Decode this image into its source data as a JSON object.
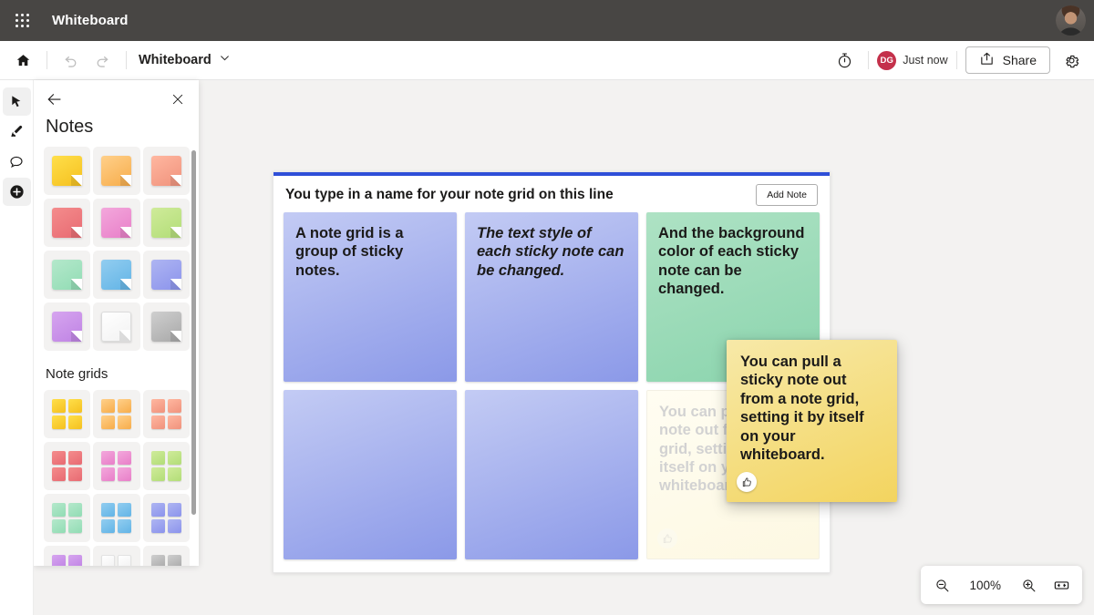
{
  "appbar": {
    "waffle_icon": "app-launcher-icon",
    "title": "Whiteboard",
    "avatar_icon": "user-avatar"
  },
  "toolbar": {
    "home_icon": "home-icon",
    "undo_icon": "undo-icon",
    "redo_icon": "redo-icon",
    "document_name": "Whiteboard",
    "chevron_icon": "chevron-down-icon",
    "timer_icon": "timer-icon",
    "presence_initials": "DG",
    "presence_status": "Just now",
    "share_icon": "share-icon",
    "share_label": "Share",
    "settings_icon": "gear-icon"
  },
  "rail": {
    "tools": [
      {
        "name": "select-tool",
        "icon": "cursor-arrow-icon",
        "selected": true
      },
      {
        "name": "pen-tool",
        "icon": "pen-icon",
        "selected": false
      },
      {
        "name": "comment-tool",
        "icon": "speech-bubble-icon",
        "selected": false
      },
      {
        "name": "create-tool",
        "icon": "plus-circle-icon",
        "selected": true
      }
    ]
  },
  "panel": {
    "back_icon": "back-arrow-icon",
    "close_icon": "close-icon",
    "title": "Notes",
    "grids_title": "Note grids",
    "note_colors": [
      {
        "label": "yellow",
        "from": "#ffdf4a",
        "to": "#f5c01f"
      },
      {
        "label": "orange",
        "from": "#ffd08a",
        "to": "#f7ac4a"
      },
      {
        "label": "peach",
        "from": "#ffb7a0",
        "to": "#f0927c"
      },
      {
        "label": "red",
        "from": "#f48c8c",
        "to": "#e86a72"
      },
      {
        "label": "pink",
        "from": "#f3a8dc",
        "to": "#e87ec8"
      },
      {
        "label": "light-green",
        "from": "#cfeb9a",
        "to": "#b2dd77"
      },
      {
        "label": "mint",
        "from": "#b4e8cb",
        "to": "#91dcb4"
      },
      {
        "label": "blue",
        "from": "#92cdf0",
        "to": "#62b4e6"
      },
      {
        "label": "periwinkle",
        "from": "#aeb5f2",
        "to": "#8b93ec"
      },
      {
        "label": "purple",
        "from": "#d6a5ef",
        "to": "#bf83e4"
      },
      {
        "label": "white",
        "from": "#ffffff",
        "to": "#f2f2f2"
      },
      {
        "label": "gray",
        "from": "#cfcfcf",
        "to": "#a8a8a8"
      }
    ]
  },
  "note_grid": {
    "title": "You type in a name for your note grid on this line",
    "add_note_label": "Add Note",
    "accent_color": "#2f4fd8",
    "notes": [
      {
        "text": "A note grid is a group of sticky notes.",
        "style": "b",
        "from": "#c3cbf4",
        "to": "#8b99e8"
      },
      {
        "text": "The text style of each sticky note can be changed.",
        "style": "bi",
        "from": "#c3cbf4",
        "to": "#8b99e8"
      },
      {
        "text": "And the background color of each sticky note can be changed.",
        "style": "b",
        "from": "#aee2c4",
        "to": "#8ad4ad"
      },
      {
        "text": "",
        "style": "b",
        "from": "#c3cbf4",
        "to": "#8b99e8"
      },
      {
        "text": "",
        "style": "b",
        "from": "#c3cbf4",
        "to": "#8b99e8"
      }
    ],
    "ghost_note": {
      "text": "You can pull a sticky note out from a note grid, setting it by itself on your whiteboard.",
      "reaction_icon": "thumbs-up-icon"
    }
  },
  "drag_note": {
    "text": "You can pull a sticky note out from a note grid, setting it by itself on your whiteboard.",
    "reaction_icon": "thumbs-up-icon"
  },
  "zoom_controls": {
    "zoom_out_icon": "zoom-out-icon",
    "level": "100%",
    "zoom_in_icon": "zoom-in-icon",
    "fit_icon": "fit-to-screen-icon"
  }
}
